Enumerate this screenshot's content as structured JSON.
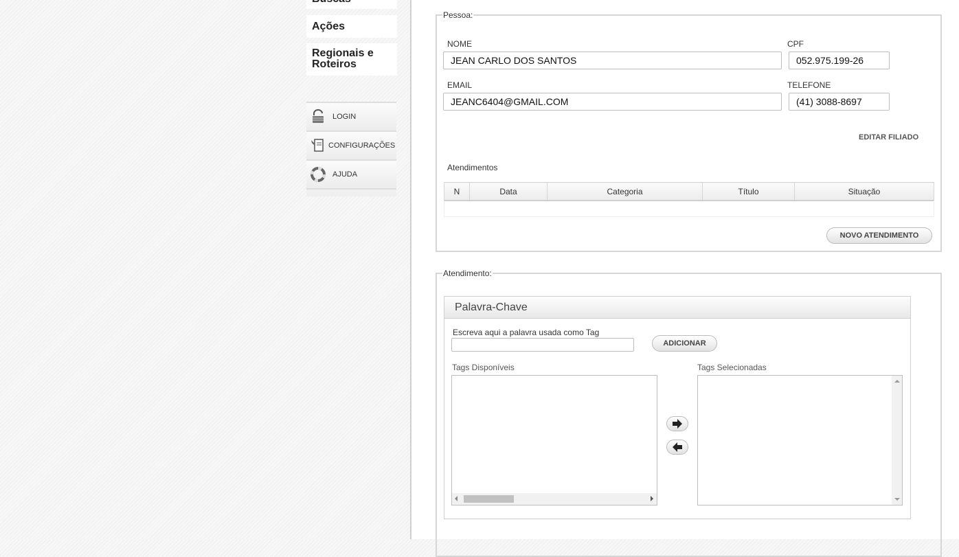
{
  "sidebar": {
    "menu_items": [
      "Buscas",
      "Ações",
      "Regionais e Roteiros"
    ],
    "utility_items": [
      {
        "label": "LOGIN",
        "icon": "lock-icon"
      },
      {
        "label": "CONFIGURAÇÕES",
        "icon": "settings-document-icon"
      },
      {
        "label": "AJUDA",
        "icon": "lifebuoy-icon"
      }
    ]
  },
  "pessoa": {
    "legend": "Pessoa:",
    "nome_label": "NOME",
    "nome_value": "JEAN CARLO DOS SANTOS",
    "cpf_label": "CPF",
    "cpf_value": "052.975.199-26",
    "email_label": "EMAIL",
    "email_value": "JEANC6404@GMAIL.COM",
    "telefone_label": "TELEFONE",
    "telefone_value": "(41) 3088-8697",
    "edit_link": "EDITAR FILIADO",
    "atendimentos_title": "Atendimentos",
    "table_columns": [
      "N",
      "Data",
      "Categoria",
      "Título",
      "Situação"
    ],
    "new_button": "NOVO ATENDIMENTO"
  },
  "atendimento": {
    "legend": "Atendimento:",
    "panel_title": "Palavra-Chave",
    "tag_input_label": "Escreva aqui a palavra usada como Tag",
    "tag_input_value": "",
    "add_button": "ADICIONAR",
    "available_label": "Tags Disponíveis",
    "selected_label": "Tags Selecionadas",
    "move_right_icon": "arrow-right-icon",
    "move_left_icon": "arrow-left-icon"
  }
}
